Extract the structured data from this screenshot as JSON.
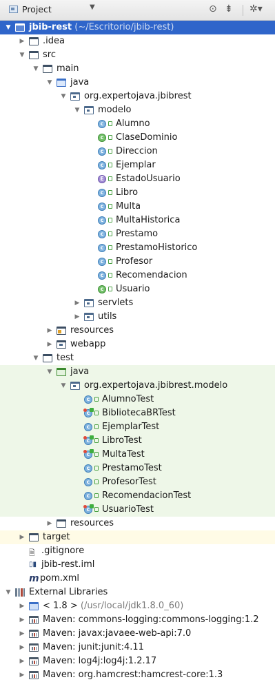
{
  "toolbar": {
    "title": "Project",
    "dropdown_icon": "chevron-down-icon",
    "buttons": [
      "sync-icon",
      "collapse-icon",
      "gear-icon"
    ]
  },
  "tree": [
    {
      "id": "r0",
      "level": 0,
      "expand": "open",
      "icon": "folder-sel",
      "label": "jbib-rest",
      "sub": "(~/Escritorio/jbib-rest)",
      "selected": true
    },
    {
      "id": "r1",
      "level": 1,
      "expand": "closed",
      "icon": "folder",
      "label": ".idea"
    },
    {
      "id": "r2",
      "level": 1,
      "expand": "open",
      "icon": "folder",
      "label": "src"
    },
    {
      "id": "r3",
      "level": 2,
      "expand": "open",
      "icon": "folder",
      "label": "main"
    },
    {
      "id": "r4",
      "level": 3,
      "expand": "open",
      "icon": "folder-blue",
      "label": "java"
    },
    {
      "id": "r5",
      "level": 4,
      "expand": "open",
      "icon": "package",
      "label": "org.expertojava.jbibrest"
    },
    {
      "id": "r6",
      "level": 5,
      "expand": "open",
      "icon": "package",
      "label": "modelo"
    },
    {
      "id": "r7",
      "level": 6,
      "icon": "class",
      "label": "Alumno"
    },
    {
      "id": "r8",
      "level": 6,
      "icon": "class-abstract",
      "label": "ClaseDominio"
    },
    {
      "id": "r9",
      "level": 6,
      "icon": "class",
      "label": "Direccion"
    },
    {
      "id": "r10",
      "level": 6,
      "icon": "class",
      "label": "Ejemplar"
    },
    {
      "id": "r11",
      "level": 6,
      "icon": "enum",
      "label": "EstadoUsuario"
    },
    {
      "id": "r12",
      "level": 6,
      "icon": "class",
      "label": "Libro"
    },
    {
      "id": "r13",
      "level": 6,
      "icon": "class",
      "label": "Multa"
    },
    {
      "id": "r14",
      "level": 6,
      "icon": "class",
      "label": "MultaHistorica"
    },
    {
      "id": "r15",
      "level": 6,
      "icon": "class",
      "label": "Prestamo"
    },
    {
      "id": "r16",
      "level": 6,
      "icon": "class",
      "label": "PrestamoHistorico"
    },
    {
      "id": "r17",
      "level": 6,
      "icon": "class",
      "label": "Profesor"
    },
    {
      "id": "r18",
      "level": 6,
      "icon": "class",
      "label": "Recomendacion"
    },
    {
      "id": "r19",
      "level": 6,
      "icon": "class-abstract",
      "label": "Usuario"
    },
    {
      "id": "r20",
      "level": 5,
      "expand": "closed",
      "icon": "package",
      "label": "servlets"
    },
    {
      "id": "r21",
      "level": 5,
      "expand": "closed",
      "icon": "package",
      "label": "utils"
    },
    {
      "id": "r22",
      "level": 3,
      "expand": "closed",
      "icon": "folder-res",
      "label": "resources"
    },
    {
      "id": "r23",
      "level": 3,
      "expand": "closed",
      "icon": "folder-web",
      "label": "webapp"
    },
    {
      "id": "r24",
      "level": 2,
      "expand": "open",
      "icon": "folder",
      "label": "test"
    },
    {
      "id": "r25",
      "level": 3,
      "expand": "open",
      "icon": "folder-src",
      "label": "java",
      "testbg": true
    },
    {
      "id": "r26",
      "level": 4,
      "expand": "open",
      "icon": "package",
      "label": "org.expertojava.jbibrest.modelo",
      "testbg": true
    },
    {
      "id": "r27",
      "level": 5,
      "icon": "class",
      "label": "AlumnoTest",
      "testbg": true
    },
    {
      "id": "r28",
      "level": 5,
      "icon": "class-testrun",
      "label": "BibliotecaBRTest",
      "testbg": true
    },
    {
      "id": "r29",
      "level": 5,
      "icon": "class",
      "label": "EjemplarTest",
      "testbg": true
    },
    {
      "id": "r30",
      "level": 5,
      "icon": "class-testrun",
      "label": "LibroTest",
      "testbg": true
    },
    {
      "id": "r31",
      "level": 5,
      "icon": "class-testrun",
      "label": "MultaTest",
      "testbg": true
    },
    {
      "id": "r32",
      "level": 5,
      "icon": "class",
      "label": "PrestamoTest",
      "testbg": true
    },
    {
      "id": "r33",
      "level": 5,
      "icon": "class",
      "label": "ProfesorTest",
      "testbg": true
    },
    {
      "id": "r34",
      "level": 5,
      "icon": "class",
      "label": "RecomendacionTest",
      "testbg": true
    },
    {
      "id": "r35",
      "level": 5,
      "icon": "class-testrun",
      "label": "UsuarioTest",
      "testbg": true
    },
    {
      "id": "r36",
      "level": 3,
      "expand": "closed",
      "icon": "folder",
      "label": "resources"
    },
    {
      "id": "r37",
      "level": 1,
      "expand": "closed",
      "icon": "folder",
      "label": "target",
      "targetbg": true
    },
    {
      "id": "r38",
      "level": 1,
      "icon": "file",
      "label": ".gitignore"
    },
    {
      "id": "r39",
      "level": 1,
      "icon": "iml",
      "label": "jbib-rest.iml"
    },
    {
      "id": "r40",
      "level": 1,
      "icon": "maven-m",
      "label": "pom.xml"
    },
    {
      "id": "r41",
      "level": 0,
      "expand": "open",
      "icon": "libraries",
      "label": "External Libraries"
    },
    {
      "id": "r42",
      "level": 1,
      "expand": "closed",
      "icon": "jdk",
      "label": "< 1.8 >",
      "sub": "(/usr/local/jdk1.8.0_60)"
    },
    {
      "id": "r43",
      "level": 1,
      "expand": "closed",
      "icon": "maven-lib",
      "label": "Maven: commons-logging:commons-logging:1.2"
    },
    {
      "id": "r44",
      "level": 1,
      "expand": "closed",
      "icon": "maven-lib",
      "label": "Maven: javax:javaee-web-api:7.0"
    },
    {
      "id": "r45",
      "level": 1,
      "expand": "closed",
      "icon": "maven-lib",
      "label": "Maven: junit:junit:4.11"
    },
    {
      "id": "r46",
      "level": 1,
      "expand": "closed",
      "icon": "maven-lib",
      "label": "Maven: log4j:log4j:1.2.17"
    },
    {
      "id": "r47",
      "level": 1,
      "expand": "closed",
      "icon": "maven-lib",
      "label": "Maven: org.hamcrest:hamcrest-core:1.3"
    }
  ]
}
